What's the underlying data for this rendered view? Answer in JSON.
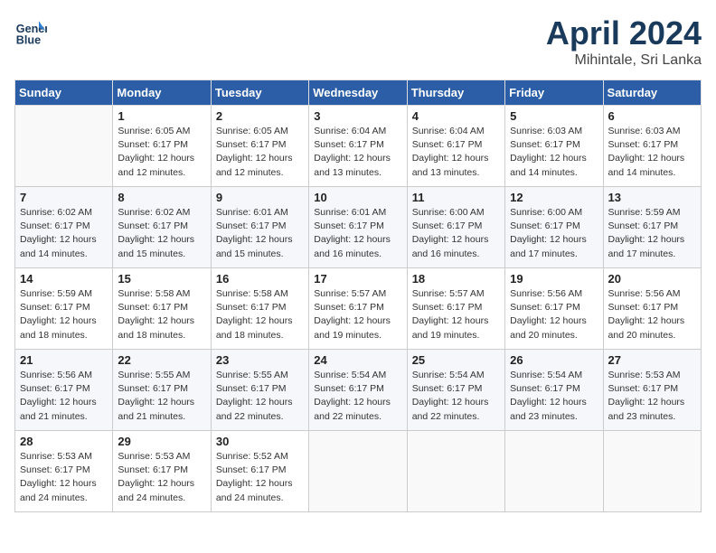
{
  "header": {
    "logo_line1": "General",
    "logo_line2": "Blue",
    "month_year": "April 2024",
    "location": "Mihintale, Sri Lanka"
  },
  "days_of_week": [
    "Sunday",
    "Monday",
    "Tuesday",
    "Wednesday",
    "Thursday",
    "Friday",
    "Saturday"
  ],
  "weeks": [
    [
      {
        "day": "",
        "info": ""
      },
      {
        "day": "1",
        "info": "Sunrise: 6:05 AM\nSunset: 6:17 PM\nDaylight: 12 hours\nand 12 minutes."
      },
      {
        "day": "2",
        "info": "Sunrise: 6:05 AM\nSunset: 6:17 PM\nDaylight: 12 hours\nand 12 minutes."
      },
      {
        "day": "3",
        "info": "Sunrise: 6:04 AM\nSunset: 6:17 PM\nDaylight: 12 hours\nand 13 minutes."
      },
      {
        "day": "4",
        "info": "Sunrise: 6:04 AM\nSunset: 6:17 PM\nDaylight: 12 hours\nand 13 minutes."
      },
      {
        "day": "5",
        "info": "Sunrise: 6:03 AM\nSunset: 6:17 PM\nDaylight: 12 hours\nand 14 minutes."
      },
      {
        "day": "6",
        "info": "Sunrise: 6:03 AM\nSunset: 6:17 PM\nDaylight: 12 hours\nand 14 minutes."
      }
    ],
    [
      {
        "day": "7",
        "info": "Sunrise: 6:02 AM\nSunset: 6:17 PM\nDaylight: 12 hours\nand 14 minutes."
      },
      {
        "day": "8",
        "info": "Sunrise: 6:02 AM\nSunset: 6:17 PM\nDaylight: 12 hours\nand 15 minutes."
      },
      {
        "day": "9",
        "info": "Sunrise: 6:01 AM\nSunset: 6:17 PM\nDaylight: 12 hours\nand 15 minutes."
      },
      {
        "day": "10",
        "info": "Sunrise: 6:01 AM\nSunset: 6:17 PM\nDaylight: 12 hours\nand 16 minutes."
      },
      {
        "day": "11",
        "info": "Sunrise: 6:00 AM\nSunset: 6:17 PM\nDaylight: 12 hours\nand 16 minutes."
      },
      {
        "day": "12",
        "info": "Sunrise: 6:00 AM\nSunset: 6:17 PM\nDaylight: 12 hours\nand 17 minutes."
      },
      {
        "day": "13",
        "info": "Sunrise: 5:59 AM\nSunset: 6:17 PM\nDaylight: 12 hours\nand 17 minutes."
      }
    ],
    [
      {
        "day": "14",
        "info": "Sunrise: 5:59 AM\nSunset: 6:17 PM\nDaylight: 12 hours\nand 18 minutes."
      },
      {
        "day": "15",
        "info": "Sunrise: 5:58 AM\nSunset: 6:17 PM\nDaylight: 12 hours\nand 18 minutes."
      },
      {
        "day": "16",
        "info": "Sunrise: 5:58 AM\nSunset: 6:17 PM\nDaylight: 12 hours\nand 18 minutes."
      },
      {
        "day": "17",
        "info": "Sunrise: 5:57 AM\nSunset: 6:17 PM\nDaylight: 12 hours\nand 19 minutes."
      },
      {
        "day": "18",
        "info": "Sunrise: 5:57 AM\nSunset: 6:17 PM\nDaylight: 12 hours\nand 19 minutes."
      },
      {
        "day": "19",
        "info": "Sunrise: 5:56 AM\nSunset: 6:17 PM\nDaylight: 12 hours\nand 20 minutes."
      },
      {
        "day": "20",
        "info": "Sunrise: 5:56 AM\nSunset: 6:17 PM\nDaylight: 12 hours\nand 20 minutes."
      }
    ],
    [
      {
        "day": "21",
        "info": "Sunrise: 5:56 AM\nSunset: 6:17 PM\nDaylight: 12 hours\nand 21 minutes."
      },
      {
        "day": "22",
        "info": "Sunrise: 5:55 AM\nSunset: 6:17 PM\nDaylight: 12 hours\nand 21 minutes."
      },
      {
        "day": "23",
        "info": "Sunrise: 5:55 AM\nSunset: 6:17 PM\nDaylight: 12 hours\nand 22 minutes."
      },
      {
        "day": "24",
        "info": "Sunrise: 5:54 AM\nSunset: 6:17 PM\nDaylight: 12 hours\nand 22 minutes."
      },
      {
        "day": "25",
        "info": "Sunrise: 5:54 AM\nSunset: 6:17 PM\nDaylight: 12 hours\nand 22 minutes."
      },
      {
        "day": "26",
        "info": "Sunrise: 5:54 AM\nSunset: 6:17 PM\nDaylight: 12 hours\nand 23 minutes."
      },
      {
        "day": "27",
        "info": "Sunrise: 5:53 AM\nSunset: 6:17 PM\nDaylight: 12 hours\nand 23 minutes."
      }
    ],
    [
      {
        "day": "28",
        "info": "Sunrise: 5:53 AM\nSunset: 6:17 PM\nDaylight: 12 hours\nand 24 minutes."
      },
      {
        "day": "29",
        "info": "Sunrise: 5:53 AM\nSunset: 6:17 PM\nDaylight: 12 hours\nand 24 minutes."
      },
      {
        "day": "30",
        "info": "Sunrise: 5:52 AM\nSunset: 6:17 PM\nDaylight: 12 hours\nand 24 minutes."
      },
      {
        "day": "",
        "info": ""
      },
      {
        "day": "",
        "info": ""
      },
      {
        "day": "",
        "info": ""
      },
      {
        "day": "",
        "info": ""
      }
    ]
  ]
}
